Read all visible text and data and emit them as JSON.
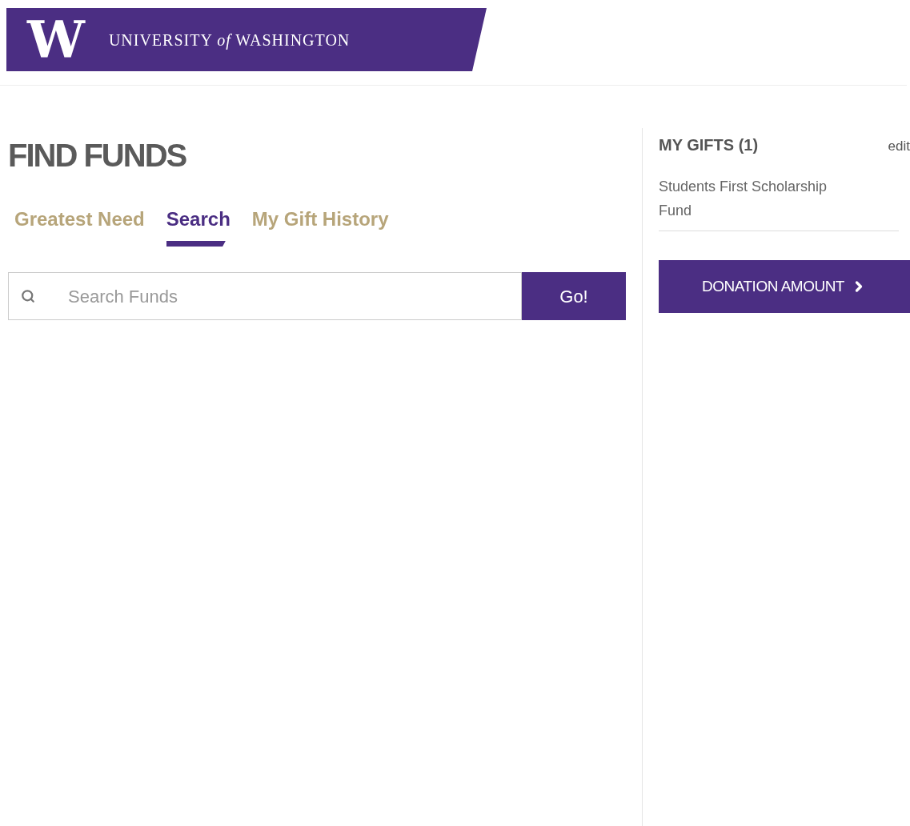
{
  "header": {
    "logo_letter": "W",
    "wordmark": "UNIVERSITY *of* WASHINGTON"
  },
  "title": "FIND FUNDS",
  "tabs": [
    {
      "label": "Greatest Need",
      "selected": false
    },
    {
      "label": "Search",
      "selected": true
    },
    {
      "label": "My Gift History",
      "selected": false
    }
  ],
  "search": {
    "placeholder": "Search Funds",
    "button": "Go!"
  },
  "gifts": {
    "title": "MY GIFTS (1)",
    "edit": "edit",
    "items": [
      "Students First Scholarship Fund"
    ],
    "button": "DONATION AMOUNT"
  }
}
